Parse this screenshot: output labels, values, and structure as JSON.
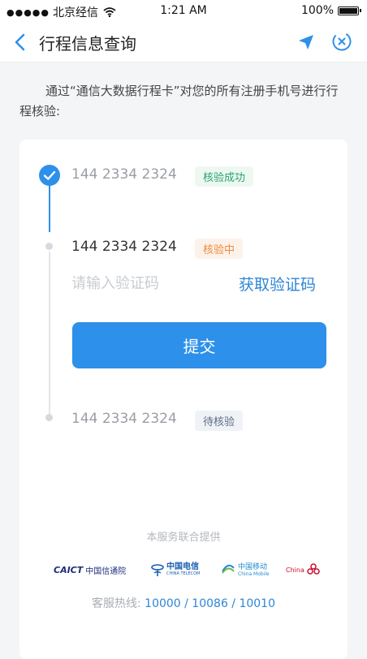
{
  "status_bar": {
    "signal_dots": "●●●●●",
    "carrier": "北京经信",
    "time": "1:21 AM",
    "battery_text": "100%"
  },
  "nav": {
    "title": "行程信息查询",
    "back_icon": "chevron-left-icon",
    "locate_icon": "location-arrow-icon",
    "close_icon": "circle-close-icon",
    "accent_color": "#2d90ea"
  },
  "intro_text": "通过“通信大数据行程卡”对您的所有注册手机号进行行程核验:",
  "steps": [
    {
      "phone": "144 2334 2324",
      "status": "核验成功",
      "state": "success"
    },
    {
      "phone": "144 2334 2324",
      "status": "核验中",
      "state": "pending"
    },
    {
      "phone": "144 2334 2324",
      "status": "待核验",
      "state": "waiting"
    }
  ],
  "verify": {
    "code_placeholder": "请输入验证码",
    "code_value": "",
    "get_code_label": "获取验证码",
    "submit_label": "提交"
  },
  "footer": {
    "provided_by": "本服务联合提供",
    "logos": [
      {
        "name": "CAICT",
        "text_en": "CAICT",
        "text_cn": "中国信通院"
      },
      {
        "name": "China Telecom",
        "text_cn": "中国电信",
        "text_en": "CHINA TELECOM"
      },
      {
        "name": "China Mobile",
        "text_cn": "中国移动",
        "text_en": "China Mobile"
      },
      {
        "name": "China Unicom",
        "text_en": "China"
      }
    ],
    "hotline_label": "客服热线:",
    "hotline_numbers": "10000 / 10086 / 10010"
  }
}
